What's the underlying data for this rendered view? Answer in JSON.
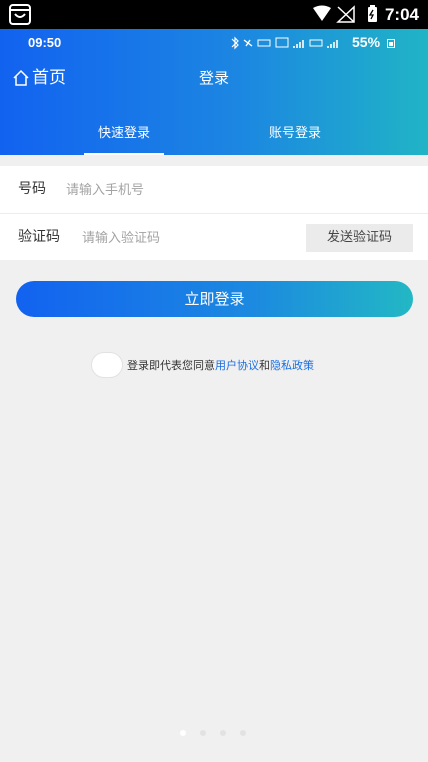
{
  "system_status": {
    "time": "7:04"
  },
  "inner_status": {
    "time": "09:50",
    "battery": "55%"
  },
  "nav": {
    "home_label": "首页",
    "title": "登录"
  },
  "tabs": [
    {
      "label": "快速登录",
      "active": true
    },
    {
      "label": "账号登录",
      "active": false
    }
  ],
  "form": {
    "phone_label": "号码",
    "phone_placeholder": "请输入手机号",
    "phone_value": "",
    "code_label": "验证码",
    "code_placeholder": "请输入验证码",
    "code_value": "",
    "send_code_label": "发送验证码"
  },
  "login_button": "立即登录",
  "agreement": {
    "prefix": "登录即代表您同意",
    "user_agreement": "用户协议",
    "and": "和",
    "privacy_policy": "隐私政策",
    "checked": false
  },
  "pager": {
    "count": 4,
    "active": 0
  },
  "colors": {
    "brand_start": "#1262f0",
    "brand_end": "#20b4c6",
    "link": "#1a6fe0"
  }
}
